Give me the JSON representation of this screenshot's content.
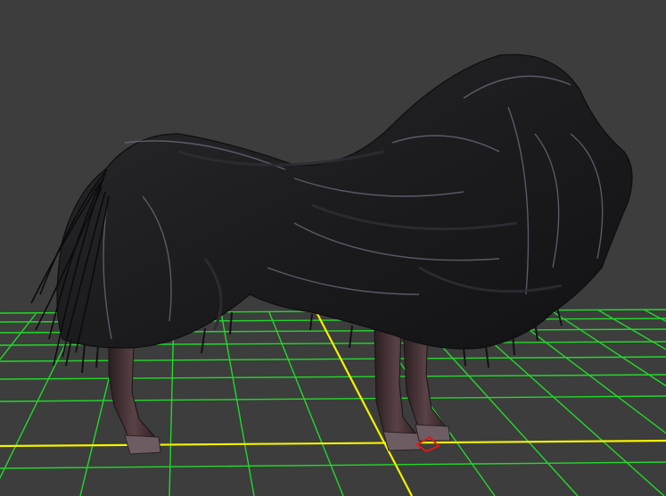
{
  "viewport": {
    "background_color": "#3d3d3d",
    "grid_color": "#22e02a",
    "axis_color": "#f2f200",
    "gizmo_color": "#e01818"
  },
  "model": {
    "icon": "draped-creature-icon",
    "cloth_color": "#1d1d1f",
    "cloth_highlight": "#7d7d8e",
    "leg_color": "#4a3538",
    "hoof_color": "#7a6a70"
  }
}
